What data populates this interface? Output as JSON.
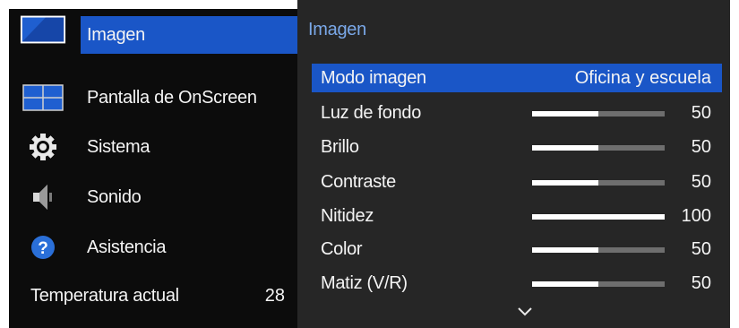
{
  "left_menu": {
    "items": [
      {
        "label": "Imagen",
        "icon": "picture-icon",
        "active": true
      },
      {
        "label": "Pantalla de OnScreen",
        "icon": "onscreen-display-icon",
        "active": false
      },
      {
        "label": "Sistema",
        "icon": "gear-icon",
        "active": false
      },
      {
        "label": "Sonido",
        "icon": "speaker-icon",
        "active": false
      },
      {
        "label": "Asistencia",
        "icon": "help-icon",
        "active": false
      }
    ],
    "temperature": {
      "label": "Temperatura actual",
      "value": "28"
    }
  },
  "submenu": {
    "title": "Imagen",
    "items": [
      {
        "label": "Modo imagen",
        "value": "Oficina y escuela",
        "selected": true
      },
      {
        "label": "Luz de fondo",
        "value": "50",
        "level": 0.5
      },
      {
        "label": "Brillo",
        "value": "50",
        "level": 0.5
      },
      {
        "label": "Contraste",
        "value": "50",
        "level": 0.5
      },
      {
        "label": "Nitidez",
        "value": "100",
        "level": 1.0
      },
      {
        "label": "Color",
        "value": "50",
        "level": 0.5
      },
      {
        "label": "Matiz (V/R)",
        "value": "50",
        "level": 0.5
      }
    ],
    "more_icon": "chevron-down-icon"
  },
  "colors": {
    "highlight": "#1a56c7",
    "title_accent": "#7aa8e8",
    "panel_bg": "#262626",
    "menu_bg": "#0c0c0c"
  }
}
